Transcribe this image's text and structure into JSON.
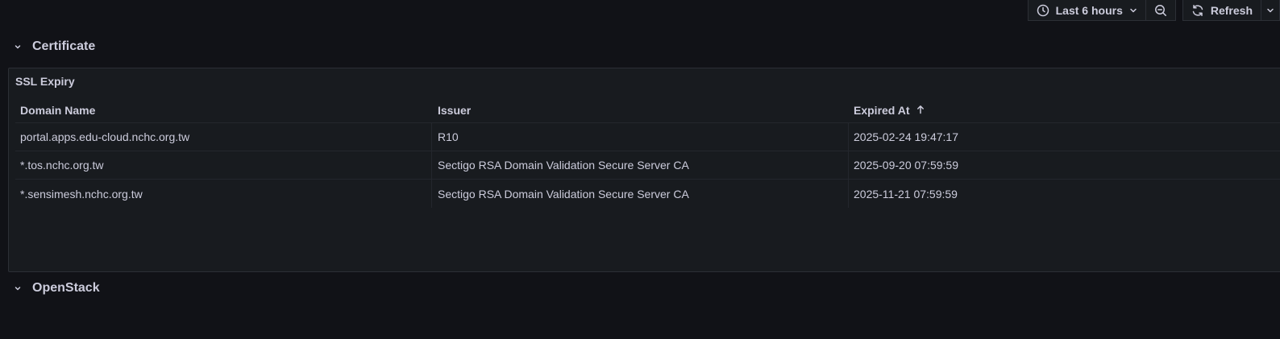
{
  "toolbar": {
    "time_range_label": "Last 6 hours",
    "refresh_label": "Refresh",
    "icons": [
      "clock-icon",
      "chevron-down-icon",
      "zoom-out-icon",
      "refresh-icon",
      "chevron-down-icon"
    ]
  },
  "rows": {
    "certificate": {
      "title": "Certificate"
    },
    "openstack": {
      "title": "OpenStack"
    }
  },
  "panel": {
    "title": "SSL Expiry",
    "columns": [
      "Domain Name",
      "Issuer",
      "Expired At"
    ],
    "sort_column": "Expired At",
    "sort_direction": "ascending",
    "records": [
      {
        "domain": "portal.apps.edu-cloud.nchc.org.tw",
        "issuer": "R10",
        "expired_at": "2025-02-24 19:47:17"
      },
      {
        "domain": "*.tos.nchc.org.tw",
        "issuer": "Sectigo RSA Domain Validation Secure Server CA",
        "expired_at": "2025-09-20 07:59:59"
      },
      {
        "domain": "*.sensimesh.nchc.org.tw",
        "issuer": "Sectigo RSA Domain Validation Secure Server CA",
        "expired_at": "2025-11-21 07:59:59"
      }
    ]
  },
  "colors": {
    "background": "#111217",
    "panel": "#181b1f",
    "border": "#2c2f36",
    "text": "#ccccdc"
  }
}
